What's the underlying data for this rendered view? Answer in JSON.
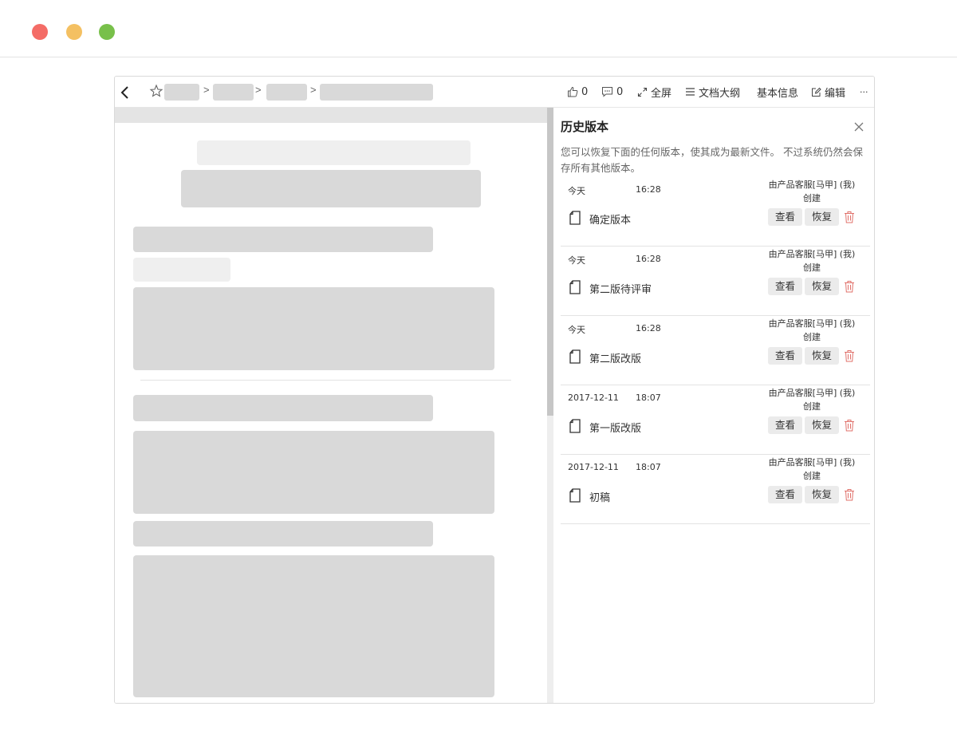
{
  "toolbar": {
    "like_count": "0",
    "comment_count": "0",
    "fullscreen_label": "全屏",
    "outline_label": "文档大纲",
    "info_label": "基本信息",
    "edit_label": "编辑",
    "more_label": "···",
    "breadcrumb_separator": ">"
  },
  "history": {
    "title": "历史版本",
    "description": "您可以恢复下面的任何版本，使其成为最新文件。 不过系统仍然会保存所有其他版本。",
    "view_label": "查看",
    "restore_label": "恢复",
    "versions": [
      {
        "date": "今天",
        "time": "16:28",
        "author": "由产品客服[马甲] (我)创建",
        "name": "确定版本"
      },
      {
        "date": "今天",
        "time": "16:28",
        "author": "由产品客服[马甲] (我)创建",
        "name": "第二版待评审"
      },
      {
        "date": "今天",
        "time": "16:28",
        "author": "由产品客服[马甲] (我)创建",
        "name": "第二版改版"
      },
      {
        "date": "2017-12-11",
        "time": "18:07",
        "author": "由产品客服[马甲] (我)创建",
        "name": "第一版改版"
      },
      {
        "date": "2017-12-11",
        "time": "18:07",
        "author": "由产品客服[马甲] (我)创建",
        "name": "初稿"
      }
    ]
  },
  "icons": {
    "back": "chevron-left-icon",
    "star": "star-icon",
    "like": "thumbs-up-icon",
    "comment": "comment-icon",
    "fullscreen": "expand-icon",
    "outline": "list-icon",
    "edit": "edit-icon",
    "close": "close-icon",
    "file": "file-icon",
    "delete": "trash-icon"
  },
  "colors": {
    "delete_icon": "#e0706a",
    "placeholder": "#d9d9d9",
    "traffic_red": "#f46c66",
    "traffic_yellow": "#f4c062",
    "traffic_green": "#78c04a"
  }
}
